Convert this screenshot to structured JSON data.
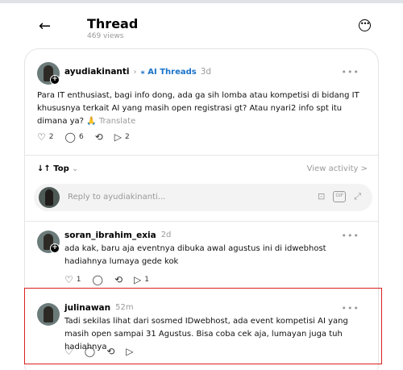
{
  "header": {
    "back_icon": "arrow-left-icon",
    "title": "Thread",
    "views": "469 views",
    "more_icon": "more-circle-icon"
  },
  "post": {
    "username": "ayudiakinanti",
    "tag": "AI Threads",
    "time": "3d",
    "text": "Para IT enthusiast, bagi info dong, ada ga sih lomba atau kompetisi di bidang IT khususnya terkait AI yang masih open registrasi gt? Atau nyari2 info spt itu dimana ya? 🙏",
    "translate": "Translate",
    "likes": "2",
    "comments": "6",
    "shares": "2"
  },
  "sort": {
    "label": "Top",
    "view_activity": "View activity >"
  },
  "reply_box": {
    "placeholder": "Reply to ayudiakinanti..."
  },
  "comments": [
    {
      "username": "soran_ibrahim_exia",
      "time": "2d",
      "text": "ada kak, baru aja eventnya dibuka awal agustus ini di idwebhost hadiahnya lumaya gede kok",
      "likes": "1",
      "shares": "1"
    },
    {
      "username": "julinawan",
      "time": "52m",
      "text": "Tadi sekilas lihat dari sosmed IDwebhost, ada event kompetisi AI yang masih open sampai 31 Agustus. Bisa coba cek aja, lumayan juga tuh hadiahnya"
    }
  ],
  "colors": {
    "accent_blue": "#1a73c8",
    "highlight_red": "#d92020",
    "muted": "#999999"
  }
}
